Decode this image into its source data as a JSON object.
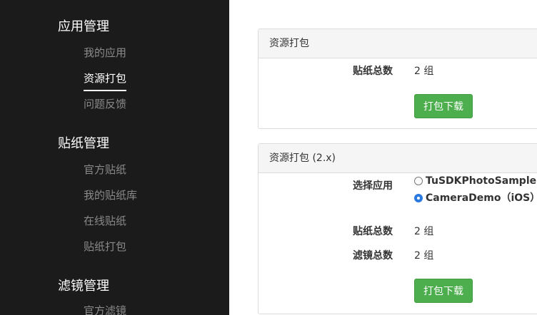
{
  "sidebar": {
    "groups": [
      {
        "title": "应用管理",
        "items": [
          "我的应用",
          "资源打包",
          "问题反馈"
        ]
      },
      {
        "title": "贴纸管理",
        "items": [
          "官方贴纸",
          "我的贴纸库",
          "在线贴纸",
          "贴纸打包"
        ]
      },
      {
        "title": "滤镜管理",
        "items": [
          "官方滤镜"
        ]
      }
    ],
    "active_item": "资源打包"
  },
  "panel1": {
    "title": "资源打包",
    "sticker_total_label": "贴纸总数",
    "sticker_total_value": "2 组",
    "download_button": "打包下载"
  },
  "panel2": {
    "title": "资源打包 (2.x)",
    "select_app_label": "选择应用",
    "apps": [
      {
        "label": "TuSDKPhotoSamplePho",
        "checked": false
      },
      {
        "label": "CameraDemo（iOS）",
        "checked": true
      }
    ],
    "sticker_total_label": "贴纸总数",
    "sticker_total_value": "2 组",
    "filter_total_label": "滤镜总数",
    "filter_total_value": "2 组",
    "download_button": "打包下载"
  },
  "colors": {
    "sidebar_bg": "#1b1b1b",
    "button_green": "#4cae4c",
    "radio_blue": "#2a7ae2"
  }
}
